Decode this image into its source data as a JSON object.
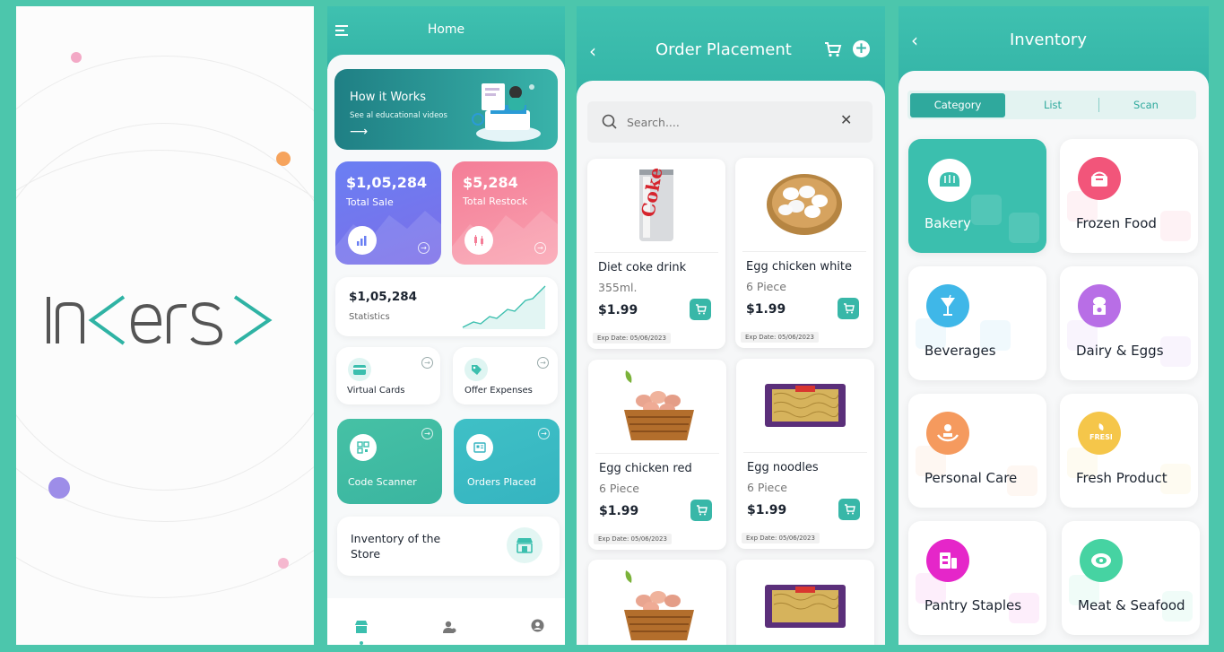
{
  "splash": {
    "logo_text": "Inkers"
  },
  "home": {
    "title": "Home",
    "banner": {
      "title": "How it Works",
      "subtitle": "See al educational videos"
    },
    "total_sale": {
      "amount": "$1,05,284",
      "label": "Total Sale"
    },
    "total_restock": {
      "amount": "$5,284",
      "label": "Total Restock"
    },
    "statistics": {
      "amount": "$1,05,284",
      "label": "Statistics"
    },
    "tiles": [
      {
        "label": "Virtual Cards"
      },
      {
        "label": "Offer Expenses"
      },
      {
        "label": "Code Scanner"
      },
      {
        "label": "Orders Placed"
      }
    ],
    "inventory_card": {
      "line1": "Inventory of the",
      "line2": "Store"
    }
  },
  "order": {
    "title": "Order Placement",
    "search_placeholder": "Search....",
    "products": [
      {
        "name": "Diet coke drink",
        "qty": "355ml.",
        "price": "$1.99",
        "exp": "Exp Date: 05/06/2023"
      },
      {
        "name": "Egg chicken white",
        "qty": "6 Piece",
        "price": "$1.99",
        "exp": "Exp Date: 05/06/2023"
      },
      {
        "name": "Egg chicken red",
        "qty": "6 Piece",
        "price": "$1.99",
        "exp": "Exp Date: 05/06/2023"
      },
      {
        "name": "Egg noodles",
        "qty": "6 Piece",
        "price": "$1.99",
        "exp": "Exp Date: 05/06/2023"
      }
    ]
  },
  "inventory": {
    "title": "Inventory",
    "tabs": [
      "Category",
      "List",
      "Scan"
    ],
    "active_tab": "Category",
    "categories": [
      {
        "label": "Bakery",
        "icon": "bread-icon",
        "color": "#3bbfae"
      },
      {
        "label": "Frozen Food",
        "icon": "frozen-food-icon",
        "color": "#f2557a"
      },
      {
        "label": "Beverages",
        "icon": "drink-icon",
        "color": "#3fb7e8"
      },
      {
        "label": "Dairy & Eggs",
        "icon": "dairy-icon",
        "color": "#b86ee6"
      },
      {
        "label": "Personal Care",
        "icon": "personal-care-icon",
        "color": "#f59a5e"
      },
      {
        "label": "Fresh Product",
        "icon": "fresh-icon",
        "color": "#f5c64a"
      },
      {
        "label": "Pantry Staples",
        "icon": "pantry-icon",
        "color": "#e526c9"
      },
      {
        "label": "Meat & Seafood",
        "icon": "meat-icon",
        "color": "#46d3a2"
      }
    ]
  },
  "colors": {
    "teal": "#3bbfae",
    "background": "#4cc6ac",
    "sale": "#6b7cf2",
    "restock": "#f47d97"
  }
}
